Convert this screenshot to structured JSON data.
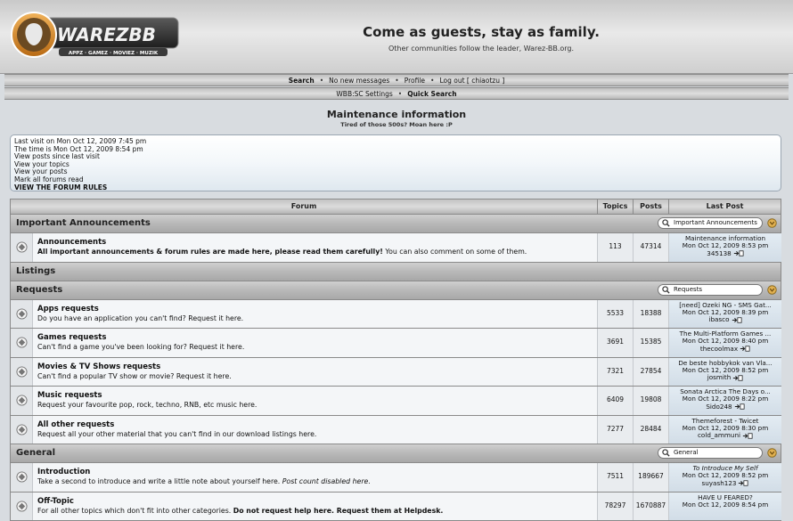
{
  "header": {
    "logo_text": "WAREZBB",
    "logo_subtitle": "APPZ · GAMEZ · MOVIEZ · MUZIK",
    "tagline_title": "Come as guests, stay as family.",
    "tagline_sub": "Other communities follow the leader, Warez-BB.org."
  },
  "nav": {
    "search": "Search",
    "new_messages": "No new messages",
    "profile": "Profile",
    "logout": "Log out [ chiaotzu ]",
    "settings": "WBB:SC Settings",
    "quick_search": "Quick Search",
    "sep": "•"
  },
  "maintenance": {
    "title": "Maintenance information",
    "subtitle": "Tired of those 500s? Moan here :P"
  },
  "info": {
    "last_visit": "Last visit on Mon Oct 12, 2009 7:45 pm",
    "time_now": "The time is Mon Oct 12, 2009 8:54 pm",
    "view_since": "View posts since last visit",
    "view_topics": "View your topics",
    "view_posts": "View your posts",
    "mark_read": "Mark all forums read",
    "rules": "VIEW THE FORUM RULES"
  },
  "table": {
    "headers": {
      "forum": "Forum",
      "topics": "Topics",
      "posts": "Posts",
      "last_post": "Last Post"
    },
    "categories": [
      {
        "title": "Important Announcements",
        "search": "Important Announcements",
        "forums": [
          {
            "name": "Announcements",
            "desc_bold": "All important announcements & forum rules are made here, please read them carefully!",
            "desc": " You can also comment on some of them.",
            "topics": "113",
            "posts": "47314",
            "last_title": "Maintenance information",
            "last_date": "Mon Oct 12, 2009 8:53 pm",
            "last_user": "345138"
          }
        ]
      },
      {
        "title": "Listings",
        "search": "",
        "forums": []
      },
      {
        "title": "Requests",
        "search": "Requests",
        "forums": [
          {
            "name": "Apps requests",
            "desc": "Do you have an application you can't find? Request it here.",
            "topics": "5533",
            "posts": "18388",
            "last_title": "[need] Ozeki NG - SMS Gat...",
            "last_date": "Mon Oct 12, 2009 8:39 pm",
            "last_user": "ibasco"
          },
          {
            "name": "Games requests",
            "desc": "Can't find a game you've been looking for? Request it here.",
            "topics": "3691",
            "posts": "15385",
            "last_title": "The Multi-Platform Games ...",
            "last_date": "Mon Oct 12, 2009 8:40 pm",
            "last_user": "thecoolmax"
          },
          {
            "name": "Movies & TV Shows requests",
            "desc": "Can't find a popular TV show or movie? Request it here.",
            "topics": "7321",
            "posts": "27854",
            "last_title": "De beste hobbykok van Vla...",
            "last_date": "Mon Oct 12, 2009 8:52 pm",
            "last_user": "josmith"
          },
          {
            "name": "Music requests",
            "desc": "Request your favourite pop, rock, techno, RNB, etc music here.",
            "topics": "6409",
            "posts": "19808",
            "last_title": "Sonata Arctica The Days o...",
            "last_date": "Mon Oct 12, 2009 8:22 pm",
            "last_user": "Sido248"
          },
          {
            "name": "All other requests",
            "desc": "Request all your other material that you can't find in our download listings here.",
            "topics": "7277",
            "posts": "28484",
            "last_title": "Themeforest - Twicet",
            "last_date": "Mon Oct 12, 2009 8:30 pm",
            "last_user": "cold_ammuni"
          }
        ]
      },
      {
        "title": "General",
        "search": "General",
        "forums": [
          {
            "name": "Introduction",
            "desc": "Take a second to introduce and write a little note about yourself here. ",
            "desc_italic": "Post count disabled here.",
            "topics": "7511",
            "posts": "189667",
            "last_title": "To Introduce My Self",
            "last_title_italic": true,
            "last_date": "Mon Oct 12, 2009 8:52 pm",
            "last_user": "suyash123"
          },
          {
            "name": "Off-Topic",
            "desc": "For all other topics which don't fit into other categories. ",
            "desc_bold": "Do not request help here. Request them at Helpdesk.",
            "topics": "78297",
            "posts": "1670887",
            "last_title": "HAVE U FEARED?",
            "last_date": "Mon Oct 12, 2009 8:54 pm",
            "last_user": ""
          }
        ]
      }
    ]
  },
  "colors": {
    "header_bg": "#d9d9d9",
    "category_bg": "#b8b8b8",
    "row_bg": "#f4f6f8",
    "lastpost_bg": "#dae4ec"
  }
}
